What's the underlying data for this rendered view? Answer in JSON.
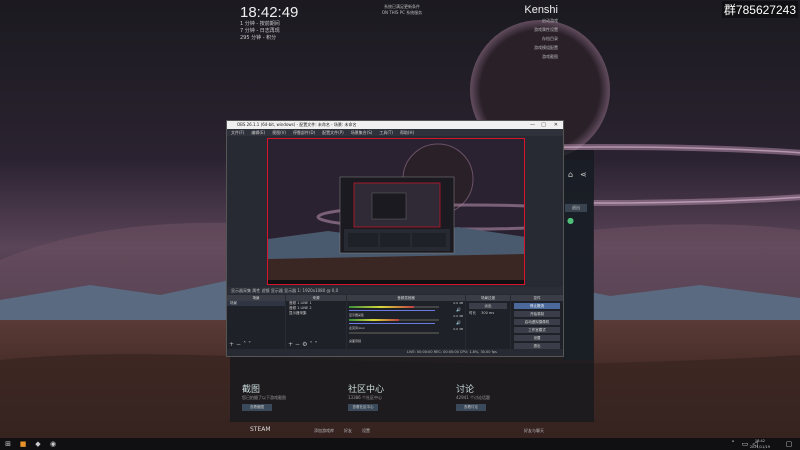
{
  "desktop": {
    "clock": {
      "time": "18:42:49",
      "lines": [
        "1 分钟 - 按前期间",
        "7 分钟 - 日志再现",
        "295 分钟 - 积分"
      ]
    },
    "center_note": [
      "系统已满足更新条件",
      "ON THIS PC 系统服务"
    ],
    "right_widget": {
      "title": "Kenshi",
      "links": [
        "启动游戏",
        "游戏属性设置",
        "存档目录",
        "游戏模组配置",
        "游戏截图"
      ]
    },
    "qq_group": "群785627243"
  },
  "obs": {
    "title": "OBS 26.1.1 (64-bit, windows) - 配置文件: 未命名 - 场景: 未命名",
    "menu": [
      "文件(F)",
      "编辑(E)",
      "视图(V)",
      "停靠部件(D)",
      "配置文件(P)",
      "场景集合(S)",
      "工具(T)",
      "帮助(H)"
    ],
    "status_line": "显示器采集   属性   滤镜   显示器  显示器 1: 1920x1080 @ 0,0",
    "docks": {
      "scenes": {
        "header": "场景",
        "items": [
          "场景"
        ]
      },
      "sources": {
        "header": "来源",
        "items": [
          "音频 1 LINE 1",
          "音频 1 LINE 2",
          "显示器采集"
        ]
      },
      "mixer": {
        "header": "音频混音器",
        "channels": [
          {
            "name": "显示器采集",
            "db": "0.0 dB",
            "level": 0.72
          },
          {
            "name": "麦克风/Aux",
            "db": "0.0 dB",
            "level": 0.55
          },
          {
            "name": "桌面音频",
            "db": "0.0 dB",
            "level": 0.0
          }
        ]
      },
      "transitions": {
        "header": "场景过渡",
        "selected": "淡出",
        "duration_label": "时长",
        "duration": "300 ms"
      },
      "controls": {
        "header": "控件",
        "buttons": [
          "停止推流",
          "开始录制",
          "启动虚拟摄像机",
          "工作室模式",
          "设置",
          "退出"
        ],
        "active_index": 0
      }
    },
    "bottom_stats": "LIVE: 00:00:00   REC: 00:00:00   CPU: 1.8%, 30.00 fps"
  },
  "steam": {
    "sidebar_button": "退出",
    "sections": [
      {
        "title": "截图",
        "subtitle": "您已拍摄了以下游戏截图",
        "button": "查看截图"
      },
      {
        "title": "社区中心",
        "subtitle": "13386 个社区中心",
        "button": "查看社区中心"
      },
      {
        "title": "讨论",
        "subtitle": "42941 个讨论话题",
        "button": "查看讨论"
      }
    ],
    "tabs": [
      "添加游戏库",
      "好友",
      "设置"
    ],
    "bar_left": "STEAM",
    "bar_right": "好友与聊天"
  },
  "taskbar": {
    "time": "18:42",
    "date": "2021/11/19"
  }
}
